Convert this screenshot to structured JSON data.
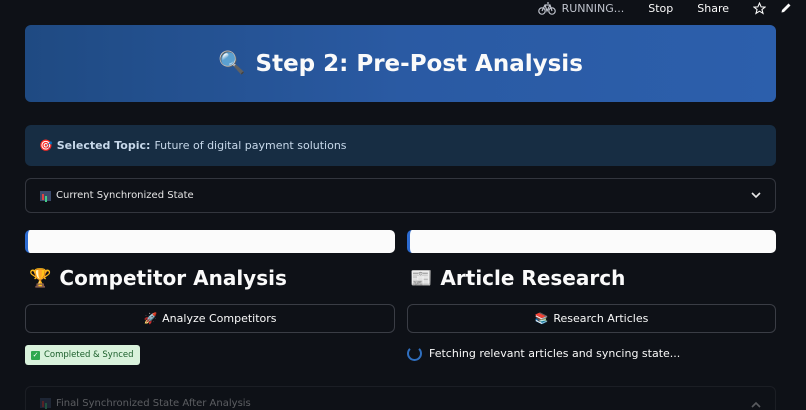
{
  "toolbar": {
    "status": "RUNNING...",
    "stop_label": "Stop",
    "share_label": "Share",
    "icons": [
      "bicycle-icon",
      "star-icon",
      "pencil-icon"
    ]
  },
  "hero": {
    "icon": "magnifier-icon",
    "title": "Step 2: Pre-Post Analysis"
  },
  "topic": {
    "icon": "target-icon",
    "label": "Selected Topic:",
    "value": "Future of digital payment solutions"
  },
  "state_expander": {
    "icon": "chart-icon",
    "label": "Current Synchronized State",
    "state": "collapsed"
  },
  "competitor": {
    "title_icon": "trophy-icon",
    "title": "Competitor Analysis",
    "button_icon": "rocket-icon",
    "button_label": "Analyze Competitors",
    "status_label": "Completed & Synced"
  },
  "articles": {
    "title_icon": "newspaper-icon",
    "title": "Article Research",
    "button_icon": "books-icon",
    "button_label": "Research Articles",
    "status_label": "Fetching relevant articles and syncing state..."
  },
  "final_expander": {
    "icon": "chart-icon",
    "label": "Final Synchronized State After Analysis",
    "state": "expanded"
  },
  "colors": {
    "background": "#0e1117",
    "hero_gradient_start": "#1f4a82",
    "hero_gradient_end": "#2c5fac",
    "topic_bg": "#172d43",
    "success_bg": "#d9f2dc",
    "success_text": "#1a5e2a",
    "accent": "#2c6bd1"
  }
}
